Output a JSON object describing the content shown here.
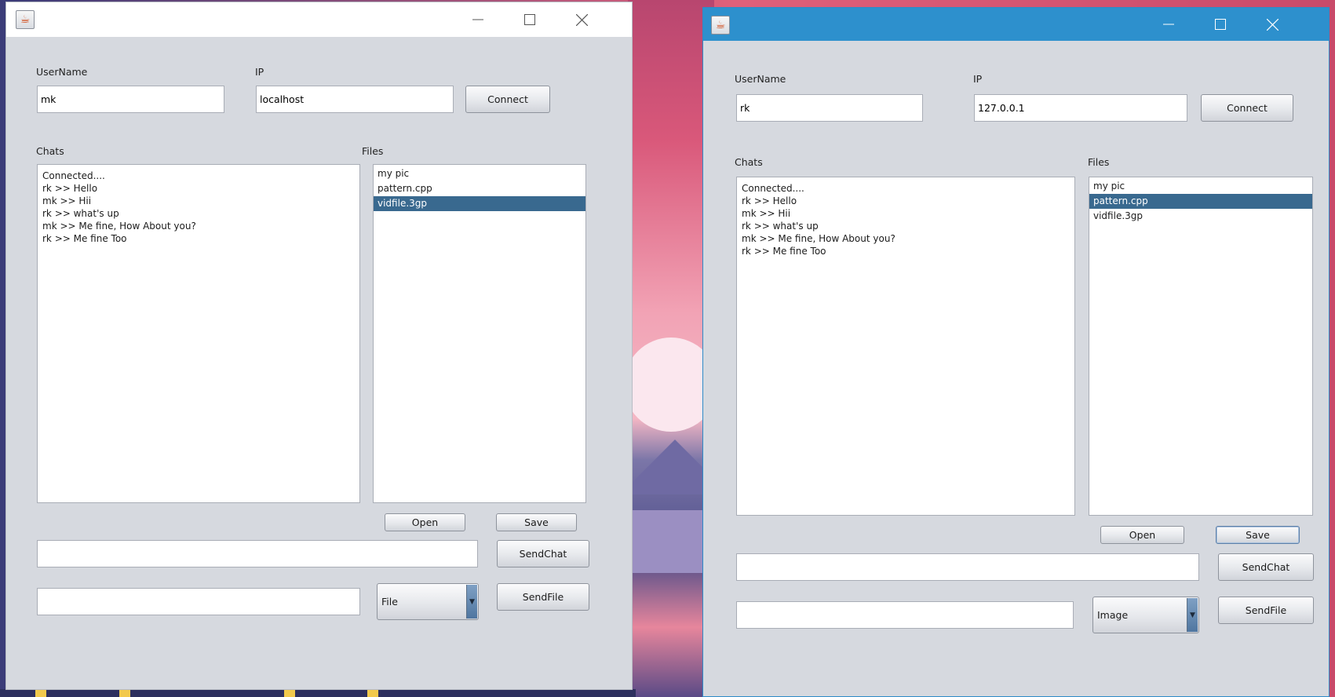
{
  "windows": [
    {
      "id": "left",
      "username_label": "UserName",
      "username_value": "mk",
      "ip_label": "IP",
      "ip_value": "localhost",
      "connect_label": "Connect",
      "chats_label": "Chats",
      "files_label": "Files",
      "chat_lines": [
        "Connected....",
        "rk >> Hello",
        "mk >> Hii",
        "rk >> what's up",
        "mk >> Me fine, How About you?",
        "rk >> Me fine Too"
      ],
      "files": [
        {
          "name": "my pic",
          "selected": false
        },
        {
          "name": "pattern.cpp",
          "selected": false
        },
        {
          "name": "vidfile.3gp",
          "selected": true
        }
      ],
      "open_label": "Open",
      "save_label": "Save",
      "chat_input": "",
      "sendchat_label": "SendChat",
      "file_input": "",
      "file_type": "File",
      "sendfile_label": "SendFile"
    },
    {
      "id": "right",
      "username_label": "UserName",
      "username_value": "rk",
      "ip_label": "IP",
      "ip_value": "127.0.0.1",
      "connect_label": "Connect",
      "chats_label": "Chats",
      "files_label": "Files",
      "chat_lines": [
        "Connected....",
        "rk >> Hello",
        "mk >> Hii",
        "rk >> what's up",
        "mk >> Me fine, How About you?",
        "rk >> Me fine Too"
      ],
      "files": [
        {
          "name": "my pic",
          "selected": false
        },
        {
          "name": "pattern.cpp",
          "selected": true
        },
        {
          "name": "vidfile.3gp",
          "selected": false
        }
      ],
      "open_label": "Open",
      "save_label": "Save",
      "chat_input": "",
      "sendchat_label": "SendChat",
      "file_input": "",
      "file_type": "Image",
      "sendfile_label": "SendFile"
    }
  ],
  "icons": {
    "app": "java-cup-icon",
    "minimize": "minimize-icon",
    "maximize": "maximize-icon",
    "close": "close-icon",
    "dropdown": "chevron-down-icon"
  },
  "colors": {
    "window_bg": "#d6d9df",
    "selection": "#39698f",
    "active_titlebar": "#2d90cd"
  }
}
